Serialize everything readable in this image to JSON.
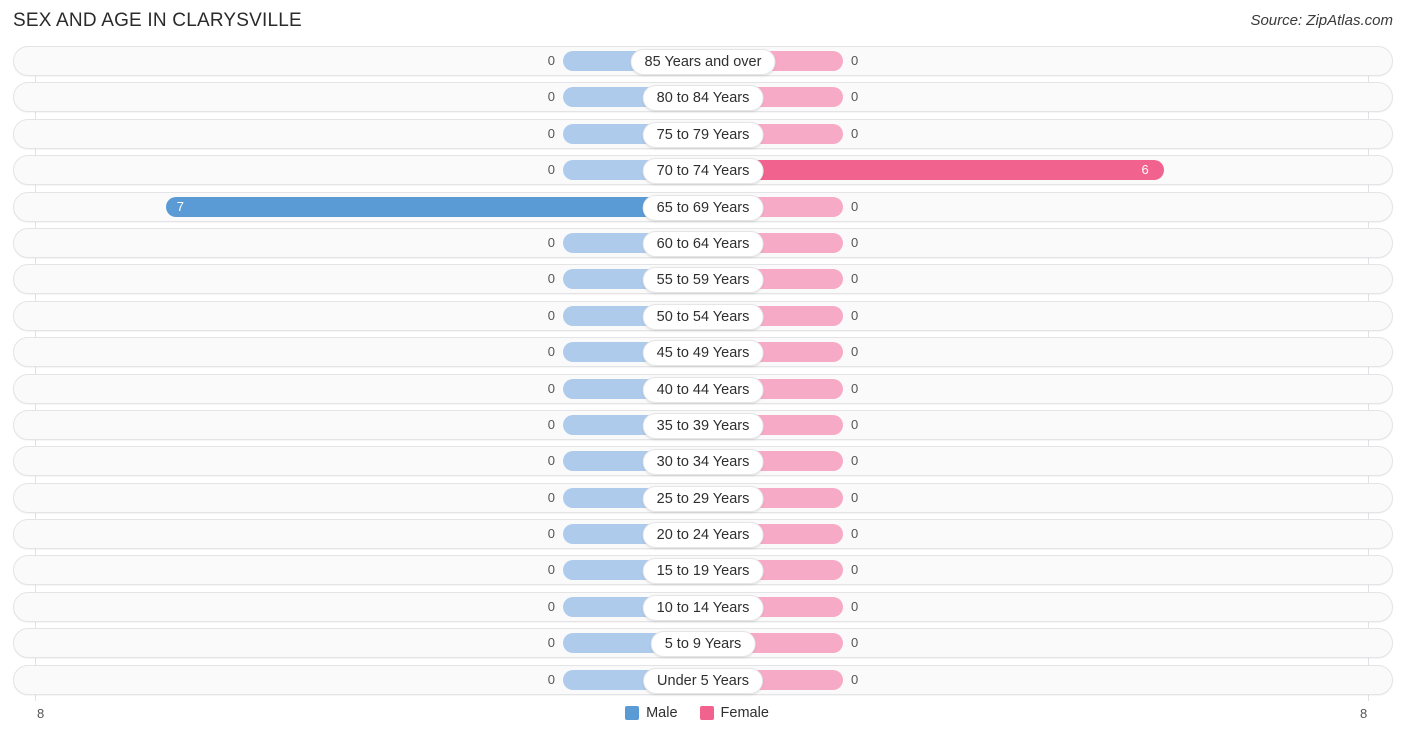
{
  "header": {
    "title": "SEX AND AGE IN CLARYSVILLE",
    "source": "Source: ZipAtlas.com"
  },
  "legend": {
    "male_label": "Male",
    "female_label": "Female",
    "male_color": "#5b9bd5",
    "female_color": "#f2628f",
    "male_stub_color": "#aecbec",
    "female_stub_color": "#f7aac6"
  },
  "axis": {
    "left_max_label": "8",
    "right_max_label": "8"
  },
  "chart_data": {
    "type": "bar",
    "title": "SEX AND AGE IN CLARYSVILLE",
    "subtitle": "Source: ZipAtlas.com",
    "orientation": "horizontal-diverging",
    "xlabel": "",
    "ylabel": "",
    "xlim": [
      8,
      8
    ],
    "axis_left_max": 8,
    "axis_right_max": 8,
    "grid": true,
    "legend_position": "bottom-center",
    "categories": [
      "85 Years and over",
      "80 to 84 Years",
      "75 to 79 Years",
      "70 to 74 Years",
      "65 to 69 Years",
      "60 to 64 Years",
      "55 to 59 Years",
      "50 to 54 Years",
      "45 to 49 Years",
      "40 to 44 Years",
      "35 to 39 Years",
      "30 to 34 Years",
      "25 to 29 Years",
      "20 to 24 Years",
      "15 to 19 Years",
      "10 to 14 Years",
      "5 to 9 Years",
      "Under 5 Years"
    ],
    "series": [
      {
        "name": "Male",
        "color": "#5b9bd5",
        "values": [
          0,
          0,
          0,
          0,
          7,
          0,
          0,
          0,
          0,
          0,
          0,
          0,
          0,
          0,
          0,
          0,
          0,
          0
        ]
      },
      {
        "name": "Female",
        "color": "#f2628f",
        "values": [
          0,
          0,
          0,
          6,
          0,
          0,
          0,
          0,
          0,
          0,
          0,
          0,
          0,
          0,
          0,
          0,
          0,
          0
        ]
      }
    ]
  },
  "rows": [
    {
      "label": "85 Years and over",
      "male": "0",
      "female": "0"
    },
    {
      "label": "80 to 84 Years",
      "male": "0",
      "female": "0"
    },
    {
      "label": "75 to 79 Years",
      "male": "0",
      "female": "0"
    },
    {
      "label": "70 to 74 Years",
      "male": "0",
      "female": "6"
    },
    {
      "label": "65 to 69 Years",
      "male": "7",
      "female": "0"
    },
    {
      "label": "60 to 64 Years",
      "male": "0",
      "female": "0"
    },
    {
      "label": "55 to 59 Years",
      "male": "0",
      "female": "0"
    },
    {
      "label": "50 to 54 Years",
      "male": "0",
      "female": "0"
    },
    {
      "label": "45 to 49 Years",
      "male": "0",
      "female": "0"
    },
    {
      "label": "40 to 44 Years",
      "male": "0",
      "female": "0"
    },
    {
      "label": "35 to 39 Years",
      "male": "0",
      "female": "0"
    },
    {
      "label": "30 to 34 Years",
      "male": "0",
      "female": "0"
    },
    {
      "label": "25 to 29 Years",
      "male": "0",
      "female": "0"
    },
    {
      "label": "20 to 24 Years",
      "male": "0",
      "female": "0"
    },
    {
      "label": "15 to 19 Years",
      "male": "0",
      "female": "0"
    },
    {
      "label": "10 to 14 Years",
      "male": "0",
      "female": "0"
    },
    {
      "label": "5 to 9 Years",
      "male": "0",
      "female": "0"
    },
    {
      "label": "Under 5 Years",
      "male": "0",
      "female": "0"
    }
  ]
}
